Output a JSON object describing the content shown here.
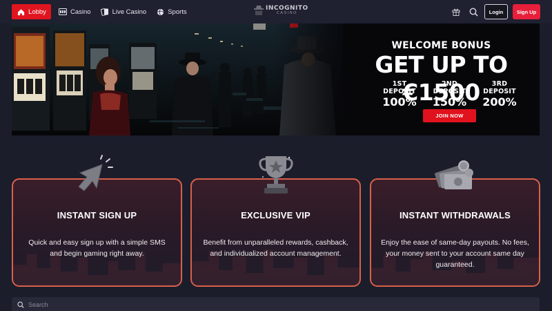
{
  "nav": {
    "items": [
      {
        "label": "Lobby",
        "icon": "home-icon",
        "active": true
      },
      {
        "label": "Casino",
        "icon": "slot-machine-icon",
        "active": false
      },
      {
        "label": "Live Casino",
        "icon": "cards-icon",
        "active": false
      },
      {
        "label": "Sports",
        "icon": "ball-icon",
        "active": false
      }
    ],
    "logo_main": "INCOGNITO",
    "logo_sub": "CASINO",
    "login_label": "Login",
    "signup_label": "Sign Up"
  },
  "banner": {
    "welcome": "WELCOME BONUS",
    "headline": "GET UP TO €1500",
    "deposits": [
      {
        "label": "1ST DEPOSIT",
        "value": "100%"
      },
      {
        "label": "2ND DEPOSIT",
        "value": "150%"
      },
      {
        "label": "3RD DEPOSIT",
        "value": "200%"
      }
    ],
    "cta": "JOIN NOW"
  },
  "features": [
    {
      "title": "INSTANT SIGN UP",
      "description": "Quick and easy sign up with a simple SMS and begin gaming right away.",
      "icon": "cursor-click-icon"
    },
    {
      "title": "EXCLUSIVE VIP",
      "description": "Benefit from unparalleled rewards, cashback, and individualized account management.",
      "icon": "trophy-icon"
    },
    {
      "title": "INSTANT WITHDRAWALS",
      "description": "Enjoy the ease of same-day payouts. No fees, your money sent to your account same day guaranteed.",
      "icon": "money-icon"
    }
  ],
  "search": {
    "placeholder": "Search"
  },
  "colors": {
    "accent_red": "#e0151f",
    "card_border": "#d9604a",
    "background": "#1c1d2b"
  }
}
